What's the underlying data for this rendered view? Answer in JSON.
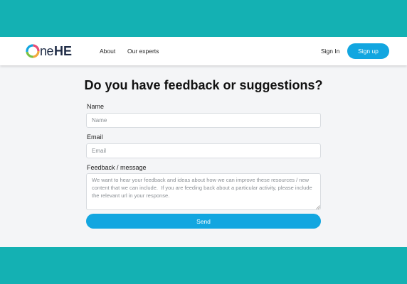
{
  "brand": {
    "logo_text": "OneHE",
    "logo_part_ne": "ne",
    "logo_part_he": "HE",
    "accent_color": "#12a6e0",
    "background_color": "#14b1b3"
  },
  "nav": {
    "links": [
      {
        "label": "About"
      },
      {
        "label": "Our experts"
      }
    ],
    "signin_label": "Sign In",
    "signup_label": "Sign up"
  },
  "form": {
    "title": "Do you have feedback or suggestions?",
    "name": {
      "label": "Name",
      "placeholder": "Name"
    },
    "email": {
      "label": "Email",
      "placeholder": "Email"
    },
    "message": {
      "label": "Feedback / message",
      "placeholder": "We want to hear your feedback and ideas about how we can improve these resources / new content that we can include.  If you are feeding back about a particular activity, please include the relevant url in your response."
    },
    "submit_label": "Send"
  }
}
